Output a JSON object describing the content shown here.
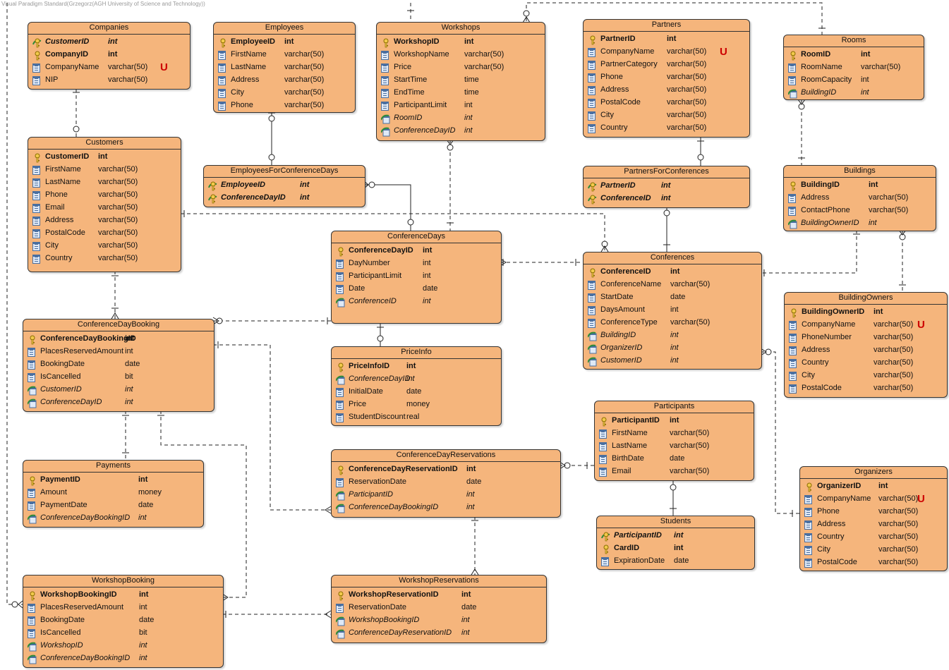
{
  "watermark": "Visual Paradigm Standard(Grzegorz(AGH University of Science and Technology))",
  "colors": {
    "entity_fill": "#F5B57C",
    "border": "#333333",
    "unique_marker": "#CC0000",
    "key_icon": "#E8C020",
    "column_icon": "#4A6FA0"
  },
  "icons": {
    "pk": "key-icon",
    "fk": "foreign-key-icon",
    "pkfk": "primary-foreign-key-icon",
    "col": "column-icon"
  },
  "entities": [
    {
      "id": "companies",
      "name": "Companies",
      "cols": [
        {
          "n": "CustomerID",
          "t": "int",
          "k": "pkfk"
        },
        {
          "n": "CompanyID",
          "t": "int",
          "k": "pk"
        },
        {
          "n": "CompanyName",
          "t": "varchar(50)",
          "k": "col",
          "u": "U"
        },
        {
          "n": "NIP",
          "t": "varchar(50)",
          "k": "col"
        }
      ]
    },
    {
      "id": "employees",
      "name": "Employees",
      "cols": [
        {
          "n": "EmployeeID",
          "t": "int",
          "k": "pk"
        },
        {
          "n": "FirstName",
          "t": "varchar(50)",
          "k": "col"
        },
        {
          "n": "LastName",
          "t": "varchar(50)",
          "k": "col"
        },
        {
          "n": "Address",
          "t": "varchar(50)",
          "k": "col"
        },
        {
          "n": "City",
          "t": "varchar(50)",
          "k": "col"
        },
        {
          "n": "Phone",
          "t": "varchar(50)",
          "k": "col"
        }
      ]
    },
    {
      "id": "workshops",
      "name": "Workshops",
      "cols": [
        {
          "n": "WorkshopID",
          "t": "int",
          "k": "pk"
        },
        {
          "n": "WorkshopName",
          "t": "varchar(50)",
          "k": "col"
        },
        {
          "n": "Price",
          "t": "varchar(50)",
          "k": "col"
        },
        {
          "n": "StartTime",
          "t": "time",
          "k": "col"
        },
        {
          "n": "EndTime",
          "t": "time",
          "k": "col"
        },
        {
          "n": "ParticipantLimit",
          "t": "int",
          "k": "col"
        },
        {
          "n": "RoomID",
          "t": "int",
          "k": "fk"
        },
        {
          "n": "ConferenceDayID",
          "t": "int",
          "k": "fk"
        }
      ]
    },
    {
      "id": "partners",
      "name": "Partners",
      "cols": [
        {
          "n": "PartnerID",
          "t": "int",
          "k": "pk"
        },
        {
          "n": "CompanyName",
          "t": "varchar(50)",
          "k": "col",
          "u": "U"
        },
        {
          "n": "PartnerCategory",
          "t": "varchar(50)",
          "k": "col"
        },
        {
          "n": "Phone",
          "t": "varchar(50)",
          "k": "col"
        },
        {
          "n": "Address",
          "t": "varchar(50)",
          "k": "col"
        },
        {
          "n": "PostalCode",
          "t": "varchar(50)",
          "k": "col"
        },
        {
          "n": "City",
          "t": "varchar(50)",
          "k": "col"
        },
        {
          "n": "Country",
          "t": "varchar(50)",
          "k": "col"
        }
      ]
    },
    {
      "id": "rooms",
      "name": "Rooms",
      "cols": [
        {
          "n": "RoomID",
          "t": "int",
          "k": "pk"
        },
        {
          "n": "RoomName",
          "t": "varchar(50)",
          "k": "col"
        },
        {
          "n": "RoomCapacity",
          "t": "int",
          "k": "col"
        },
        {
          "n": "BuildingID",
          "t": "int",
          "k": "fk"
        }
      ]
    },
    {
      "id": "customers",
      "name": "Customers",
      "cols": [
        {
          "n": "CustomerID",
          "t": "int",
          "k": "pk"
        },
        {
          "n": "FirstName",
          "t": "varchar(50)",
          "k": "col"
        },
        {
          "n": "LastName",
          "t": "varchar(50)",
          "k": "col"
        },
        {
          "n": "Phone",
          "t": "varchar(50)",
          "k": "col"
        },
        {
          "n": "Email",
          "t": "varchar(50)",
          "k": "col"
        },
        {
          "n": "Address",
          "t": "varchar(50)",
          "k": "col"
        },
        {
          "n": "PostalCode",
          "t": "varchar(50)",
          "k": "col"
        },
        {
          "n": "City",
          "t": "varchar(50)",
          "k": "col"
        },
        {
          "n": "Country",
          "t": "varchar(50)",
          "k": "col"
        }
      ]
    },
    {
      "id": "employeesforconferencedays",
      "name": "EmployeesForConferenceDays",
      "cols": [
        {
          "n": "EmployeeID",
          "t": "int",
          "k": "pkfk"
        },
        {
          "n": "ConferenceDayID",
          "t": "int",
          "k": "pkfk"
        }
      ]
    },
    {
      "id": "partnersforconferences",
      "name": "PartnersForConferences",
      "cols": [
        {
          "n": "PartnerID",
          "t": "int",
          "k": "pkfk"
        },
        {
          "n": "ConferenceID",
          "t": "int",
          "k": "pkfk"
        }
      ]
    },
    {
      "id": "buildings",
      "name": "Buildings",
      "cols": [
        {
          "n": "BuildingID",
          "t": "int",
          "k": "pk"
        },
        {
          "n": "Address",
          "t": "varchar(50)",
          "k": "col"
        },
        {
          "n": "ContactPhone",
          "t": "varchar(50)",
          "k": "col"
        },
        {
          "n": "BuildingOwnerID",
          "t": "int",
          "k": "fk"
        }
      ]
    },
    {
      "id": "conferencedays",
      "name": "ConferenceDays",
      "cols": [
        {
          "n": "ConferenceDayID",
          "t": "int",
          "k": "pk"
        },
        {
          "n": "DayNumber",
          "t": "int",
          "k": "col"
        },
        {
          "n": "ParticipantLimit",
          "t": "int",
          "k": "col"
        },
        {
          "n": "Date",
          "t": "date",
          "k": "col"
        },
        {
          "n": "ConferenceID",
          "t": "int",
          "k": "fk"
        }
      ]
    },
    {
      "id": "conferences",
      "name": "Conferences",
      "cols": [
        {
          "n": "ConferenceID",
          "t": "int",
          "k": "pk"
        },
        {
          "n": "ConferenceName",
          "t": "varchar(50)",
          "k": "col"
        },
        {
          "n": "StartDate",
          "t": "date",
          "k": "col"
        },
        {
          "n": "DaysAmount",
          "t": "int",
          "k": "col"
        },
        {
          "n": "ConferenceType",
          "t": "varchar(50)",
          "k": "col"
        },
        {
          "n": "BuildingID",
          "t": "int",
          "k": "fk"
        },
        {
          "n": "OrganizerID",
          "t": "int",
          "k": "fk"
        },
        {
          "n": "CustomerID",
          "t": "int",
          "k": "fk"
        }
      ]
    },
    {
      "id": "buildingowners",
      "name": "BuildingOwners",
      "cols": [
        {
          "n": "BuildingOwnerID",
          "t": "int",
          "k": "pk"
        },
        {
          "n": "CompanyName",
          "t": "varchar(50)",
          "k": "col",
          "u": "U"
        },
        {
          "n": "PhoneNumber",
          "t": "varchar(50)",
          "k": "col"
        },
        {
          "n": "Address",
          "t": "varchar(50)",
          "k": "col"
        },
        {
          "n": "Country",
          "t": "varchar(50)",
          "k": "col"
        },
        {
          "n": "City",
          "t": "varchar(50)",
          "k": "col"
        },
        {
          "n": "PostalCode",
          "t": "varchar(50)",
          "k": "col"
        }
      ]
    },
    {
      "id": "conferencedaybooking",
      "name": "ConferenceDayBooking",
      "cols": [
        {
          "n": "ConferenceDayBookingID",
          "t": "int",
          "k": "pk"
        },
        {
          "n": "PlacesReservedAmount",
          "t": "int",
          "k": "col"
        },
        {
          "n": "BookingDate",
          "t": "date",
          "k": "col"
        },
        {
          "n": "IsCancelled",
          "t": "bit",
          "k": "col"
        },
        {
          "n": "CustomerID",
          "t": "int",
          "k": "fk"
        },
        {
          "n": "ConferenceDayID",
          "t": "int",
          "k": "fk"
        }
      ]
    },
    {
      "id": "priceinfo",
      "name": "PriceInfo",
      "cols": [
        {
          "n": "PriceInfoID",
          "t": "int",
          "k": "pk"
        },
        {
          "n": "ConferenceDayID",
          "t": "int",
          "k": "fk"
        },
        {
          "n": "InitialDate",
          "t": "date",
          "k": "col"
        },
        {
          "n": "Price",
          "t": "money",
          "k": "col"
        },
        {
          "n": "StudentDiscount",
          "t": "real",
          "k": "col"
        }
      ]
    },
    {
      "id": "participants",
      "name": "Participants",
      "cols": [
        {
          "n": "ParticipantID",
          "t": "int",
          "k": "pk"
        },
        {
          "n": "FirstName",
          "t": "varchar(50)",
          "k": "col"
        },
        {
          "n": "LastName",
          "t": "varchar(50)",
          "k": "col"
        },
        {
          "n": "BirthDate",
          "t": "date",
          "k": "col"
        },
        {
          "n": "Email",
          "t": "varchar(50)",
          "k": "col"
        }
      ]
    },
    {
      "id": "payments",
      "name": "Payments",
      "cols": [
        {
          "n": "PaymentID",
          "t": "int",
          "k": "pk"
        },
        {
          "n": "Amount",
          "t": "money",
          "k": "col"
        },
        {
          "n": "PaymentDate",
          "t": "date",
          "k": "col"
        },
        {
          "n": "ConferenceDayBookingID",
          "t": "int",
          "k": "fk"
        }
      ]
    },
    {
      "id": "conferencedayreservations",
      "name": "ConferenceDayReservations",
      "cols": [
        {
          "n": "ConferenceDayReservationID",
          "t": "int",
          "k": "pk"
        },
        {
          "n": "ReservationDate",
          "t": "date",
          "k": "col"
        },
        {
          "n": "ParticipantID",
          "t": "int",
          "k": "fk"
        },
        {
          "n": "ConferenceDayBookingID",
          "t": "int",
          "k": "fk"
        }
      ]
    },
    {
      "id": "organizers",
      "name": "Organizers",
      "cols": [
        {
          "n": "OrganizerID",
          "t": "int",
          "k": "pk"
        },
        {
          "n": "CompanyName",
          "t": "varchar(50)",
          "k": "col",
          "u": "U"
        },
        {
          "n": "Phone",
          "t": "varchar(50)",
          "k": "col"
        },
        {
          "n": "Address",
          "t": "varchar(50)",
          "k": "col"
        },
        {
          "n": "Country",
          "t": "varchar(50)",
          "k": "col"
        },
        {
          "n": "City",
          "t": "varchar(50)",
          "k": "col"
        },
        {
          "n": "PostalCode",
          "t": "varchar(50)",
          "k": "col"
        }
      ]
    },
    {
      "id": "students",
      "name": "Students",
      "cols": [
        {
          "n": "ParticipantID",
          "t": "int",
          "k": "pkfk"
        },
        {
          "n": "CardID",
          "t": "int",
          "k": "pk"
        },
        {
          "n": "ExpirationDate",
          "t": "date",
          "k": "col"
        }
      ]
    },
    {
      "id": "workshopbooking",
      "name": "WorkshopBooking",
      "cols": [
        {
          "n": "WorkshopBookingID",
          "t": "int",
          "k": "pk"
        },
        {
          "n": "PlacesReservedAmount",
          "t": "int",
          "k": "col"
        },
        {
          "n": "BookingDate",
          "t": "date",
          "k": "col"
        },
        {
          "n": "IsCancelled",
          "t": "bit",
          "k": "col"
        },
        {
          "n": "WorkshopID",
          "t": "int",
          "k": "fk"
        },
        {
          "n": "ConferenceDayBookingID",
          "t": "int",
          "k": "fk"
        }
      ]
    },
    {
      "id": "workshopreservations",
      "name": "WorkshopReservations",
      "cols": [
        {
          "n": "WorkshopReservationID",
          "t": "int",
          "k": "pk"
        },
        {
          "n": "ReservationDate",
          "t": "date",
          "k": "col"
        },
        {
          "n": "WorkshopBookingID",
          "t": "int",
          "k": "fk"
        },
        {
          "n": "ConferenceDayReservationID",
          "t": "int",
          "k": "fk"
        }
      ]
    }
  ]
}
